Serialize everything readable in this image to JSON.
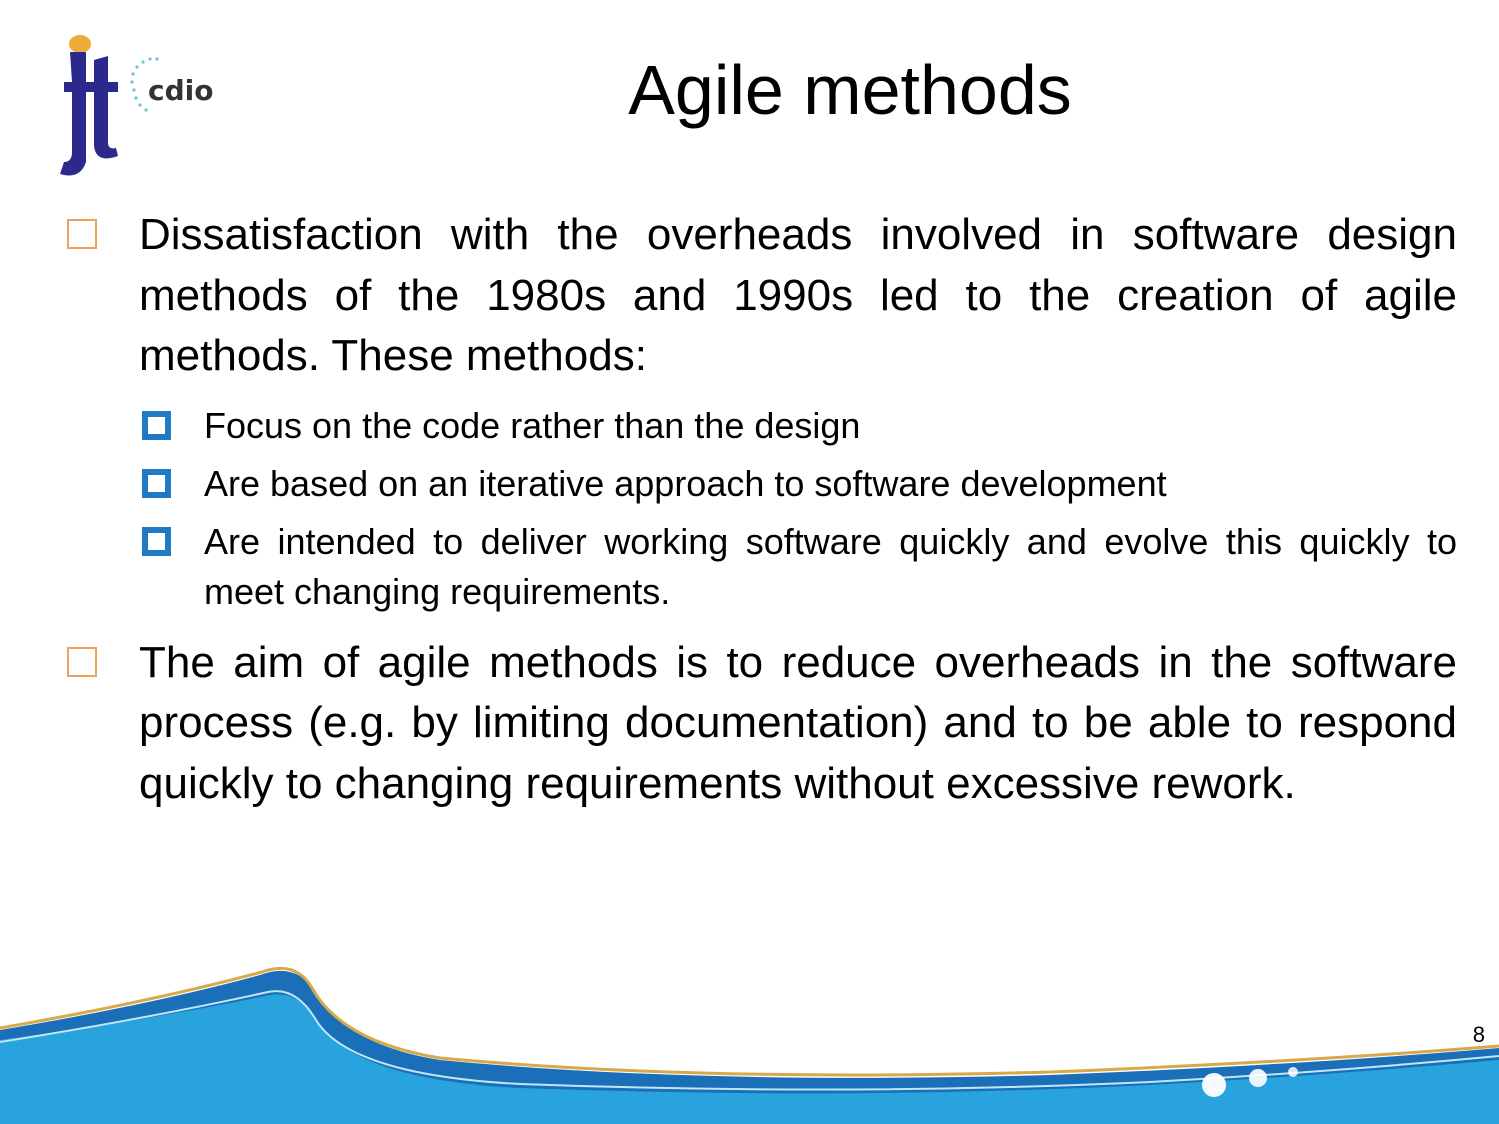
{
  "header": {
    "logo_text": "cdio",
    "title": "Agile methods"
  },
  "content": {
    "bullets": [
      {
        "text": "Dissatisfaction with the overheads involved in software design methods of the 1980s and 1990s led to the creation of agile methods. These methods:",
        "sub_bullets": [
          "Focus on the code rather than the design",
          "Are based on an iterative approach to software development",
          "Are intended to deliver working software quickly and evolve this quickly to meet changing requirements."
        ]
      },
      {
        "text": "The aim of agile methods is to reduce overheads in the software process (e.g. by limiting documentation) and to be able to respond quickly to changing requirements without excessive rework.",
        "sub_bullets": []
      }
    ]
  },
  "footer": {
    "page_number": "8"
  },
  "colors": {
    "level1_bullet": "#f0a05a",
    "level2_bullet": "#1f7ac6",
    "wave_light": "#29a3dd",
    "wave_dark": "#1a6fb8",
    "wave_gold": "#d8a84a"
  }
}
